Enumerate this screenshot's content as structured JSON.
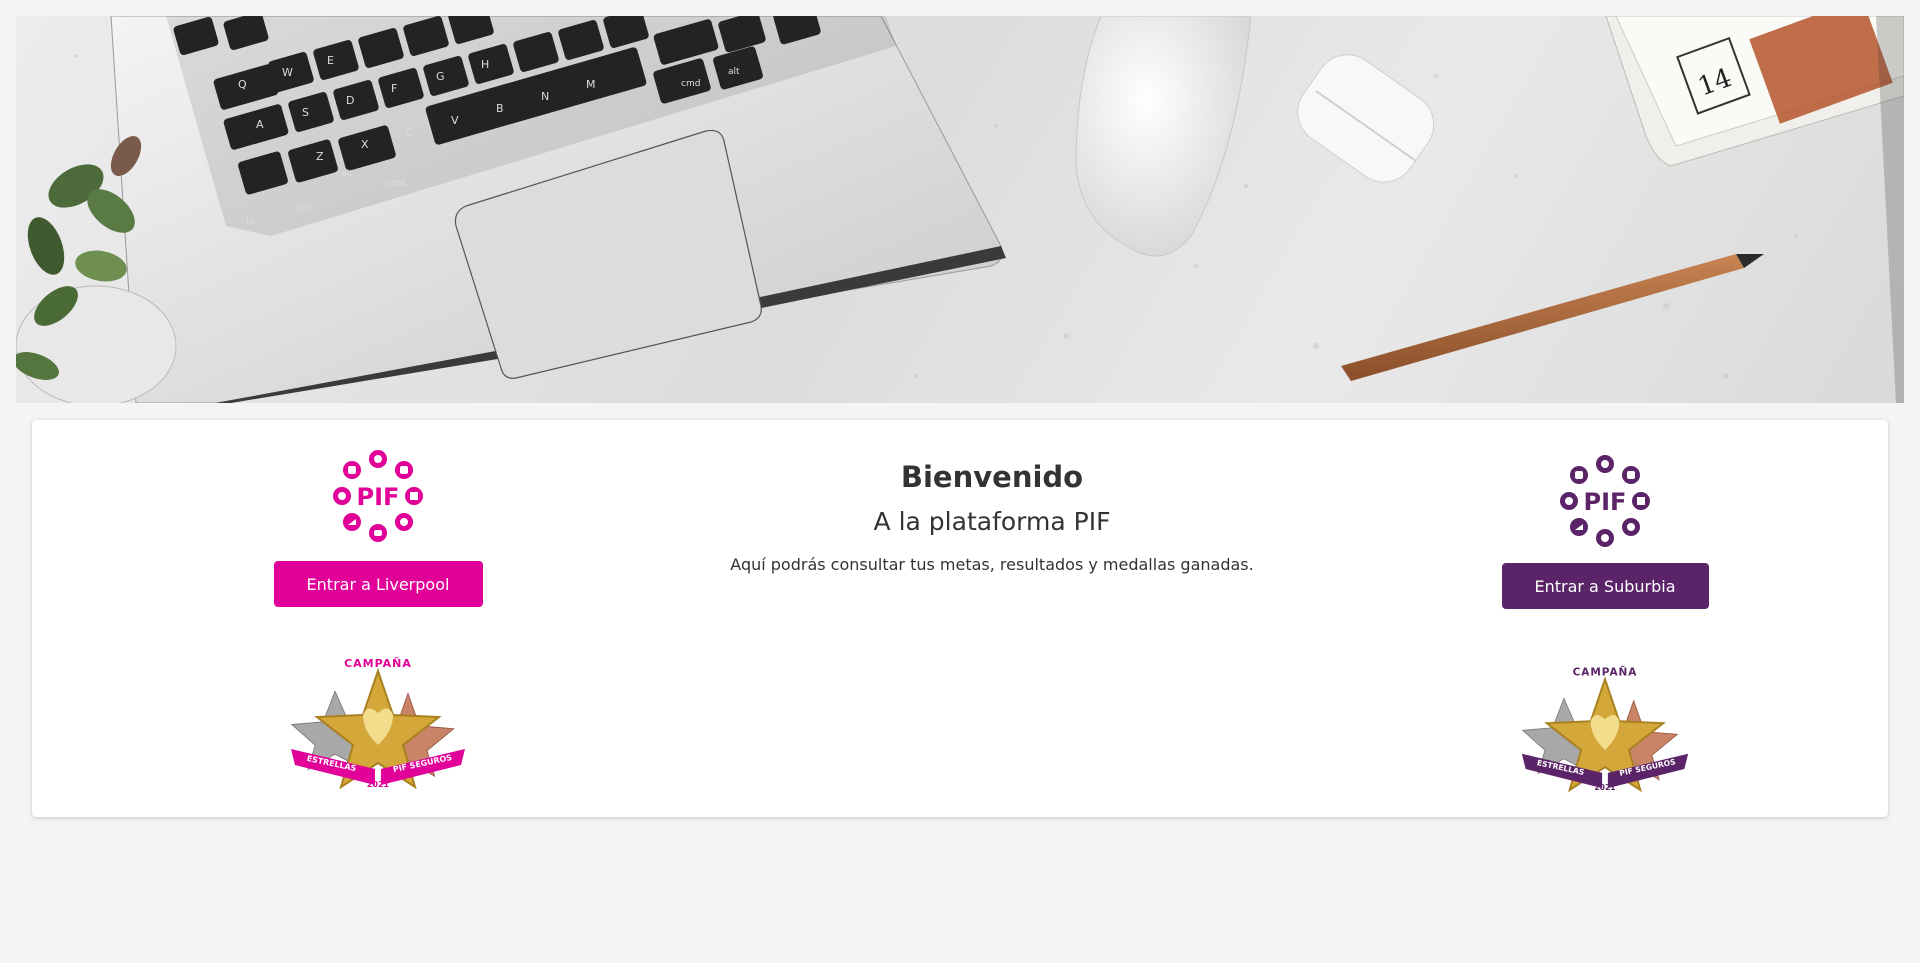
{
  "hero": {
    "keyboard_keys": [
      "Q",
      "W",
      "E",
      "A",
      "S",
      "D",
      "F",
      "G",
      "H",
      "Z",
      "X",
      "C",
      "V",
      "B",
      "N",
      "M",
      "fn",
      "ctrl",
      "alt",
      "cmd",
      "cmd",
      "alt"
    ],
    "newspaper_text": "14"
  },
  "left_column": {
    "logo_text": "PIF",
    "button_label": "Entrar a Liverpool",
    "badge": {
      "top_text": "CAMPAÑA",
      "ribbon_left": "ESTRELLAS",
      "ribbon_right": "PIF SEGUROS",
      "year": "2021"
    }
  },
  "welcome": {
    "title": "Bienvenido",
    "subtitle": "A la plataforma PIF",
    "text": "Aquí podrás consultar tus metas, resultados y medallas ganadas."
  },
  "right_column": {
    "logo_text": "PIF",
    "button_label": "Entrar a Suburbia",
    "badge": {
      "top_text": "CAMPAÑA",
      "ribbon_left": "ESTRELLAS",
      "ribbon_right": "PIF SEGUROS",
      "year": "2021"
    }
  },
  "colors": {
    "liverpool_pink": "#e10098",
    "suburbia_purple": "#5b2468",
    "gold": "#d4a73a",
    "page_background": "#f4f4f4"
  }
}
